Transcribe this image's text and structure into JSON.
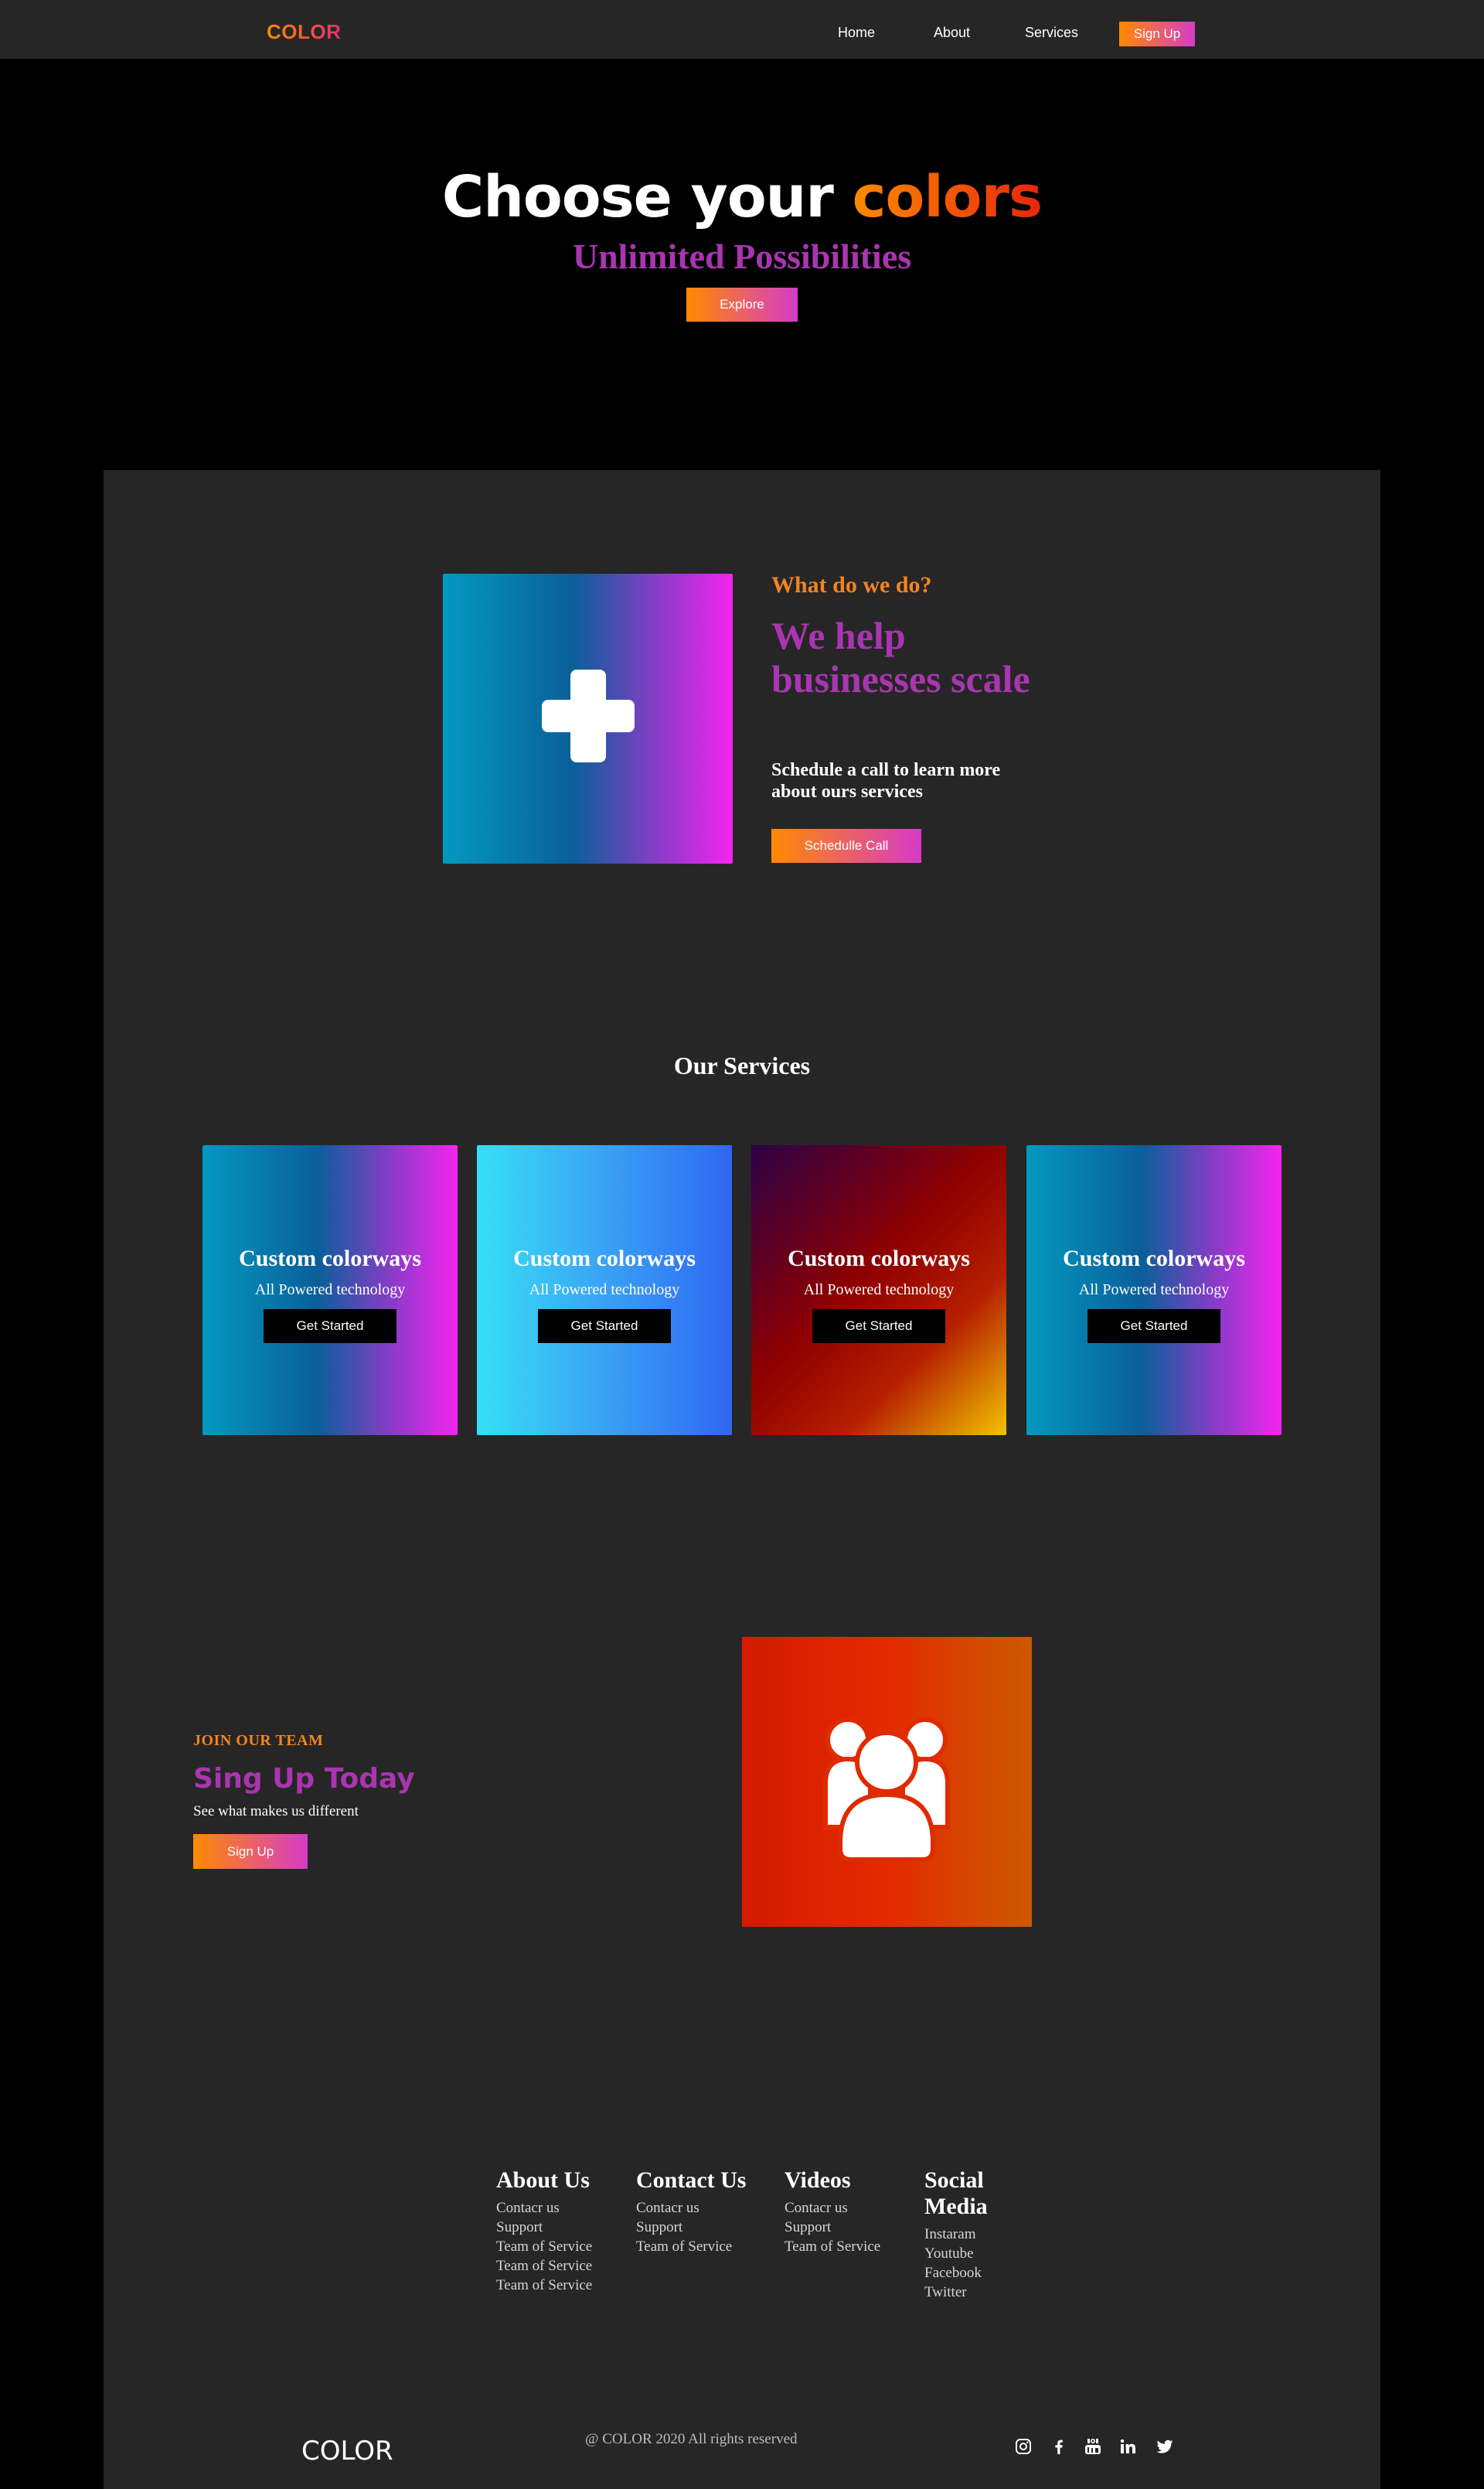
{
  "nav": {
    "logo": "COLOR",
    "links": [
      "Home",
      "About",
      "Services"
    ],
    "signup_label": "Sign Up"
  },
  "hero": {
    "title_main": "Choose your ",
    "title_accent": "colors",
    "subtitle": "Unlimited Possibilities",
    "button_label": "Explore"
  },
  "help": {
    "eyebrow": "What do we do?",
    "title": "We help businesses scale",
    "description": "Schedule a call to learn more about ours services",
    "button_label": "Schedulle Call",
    "image_icon": "plus-icon"
  },
  "services": {
    "title": "Our Services",
    "cards": [
      {
        "title": "Custom colorways",
        "subtitle": "All Powered technology",
        "button_label": "Get Started"
      },
      {
        "title": "Custom colorways",
        "subtitle": "All Powered technology",
        "button_label": "Get Started"
      },
      {
        "title": "Custom colorways",
        "subtitle": "All Powered technology",
        "button_label": "Get Started"
      },
      {
        "title": "Custom colorways",
        "subtitle": "All Powered technology",
        "button_label": "Get Started"
      }
    ]
  },
  "join": {
    "eyebrow": "JOIN OUR TEAM",
    "title": "Sing Up Today",
    "description": "See what makes us different",
    "button_label": "Sign Up",
    "image_icon": "users-icon"
  },
  "footer": {
    "columns": [
      {
        "heading": "About Us",
        "links": [
          "Contacr us",
          "Support",
          "Team of Service",
          "Team of Service",
          "Team of Service"
        ]
      },
      {
        "heading": "Contact Us",
        "links": [
          "Contacr us",
          "Support",
          "Team of Service"
        ]
      },
      {
        "heading": "Videos",
        "links": [
          "Contacr us",
          "Support",
          "Team of Service"
        ]
      },
      {
        "heading": "Social Media",
        "links": [
          "Instaram",
          "Youtube",
          "Facebook",
          "Twitter"
        ]
      }
    ],
    "logo": "COLOR",
    "copyright": "@ COLOR 2020 All rights reserved",
    "social_icons": [
      "instagram-icon",
      "facebook-icon",
      "youtube-icon",
      "linkedin-icon",
      "twitter-icon"
    ]
  },
  "colors": {
    "accent_orange": "#ff8a00",
    "accent_purple": "#a935b0",
    "panel_bg": "#262626",
    "page_bg": "#000000"
  }
}
